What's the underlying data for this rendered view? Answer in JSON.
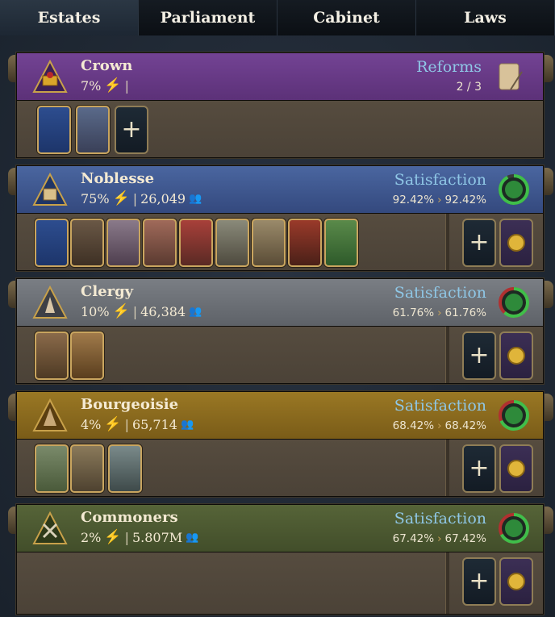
{
  "tabs": [
    "Estates",
    "Parliament",
    "Cabinet",
    "Laws"
  ],
  "active_tab": "Estates",
  "crown": {
    "name": "Crown",
    "power": "7%",
    "reforms_label": "Reforms",
    "reforms_value": "2 / 3"
  },
  "estates": [
    {
      "name": "Noblesse",
      "power": "75%",
      "population": "26,049",
      "sat_label": "Satisfaction",
      "sat_current": "92.42%",
      "sat_target": "92.42%",
      "sat_level": 0.9242
    },
    {
      "name": "Clergy",
      "power": "10%",
      "population": "46,384",
      "sat_label": "Satisfaction",
      "sat_current": "61.76%",
      "sat_target": "61.76%",
      "sat_level": 0.6176
    },
    {
      "name": "Bourgeoisie",
      "power": "4%",
      "population": "65,714",
      "sat_label": "Satisfaction",
      "sat_current": "68.42%",
      "sat_target": "68.42%",
      "sat_level": 0.6842
    },
    {
      "name": "Commoners",
      "power": "2%",
      "population": "5.807M",
      "sat_label": "Satisfaction",
      "sat_current": "67.42%",
      "sat_target": "67.42%",
      "sat_level": 0.6742
    }
  ],
  "colors": {
    "crown": "#6a3b86",
    "noblesse": "#3f5890",
    "clergy": "#6d7177",
    "bourgeoisie": "#8a6a1e",
    "commoners": "#4d5a32",
    "satisfaction_label": "#8fc7e6",
    "bolt": "#f5c02a"
  },
  "icons": {
    "power": "lightning-bolt-icon",
    "population": "people-icon",
    "add": "plus-icon",
    "coins": "gold-coins-icon",
    "reforms": "scroll-quill-icon"
  }
}
